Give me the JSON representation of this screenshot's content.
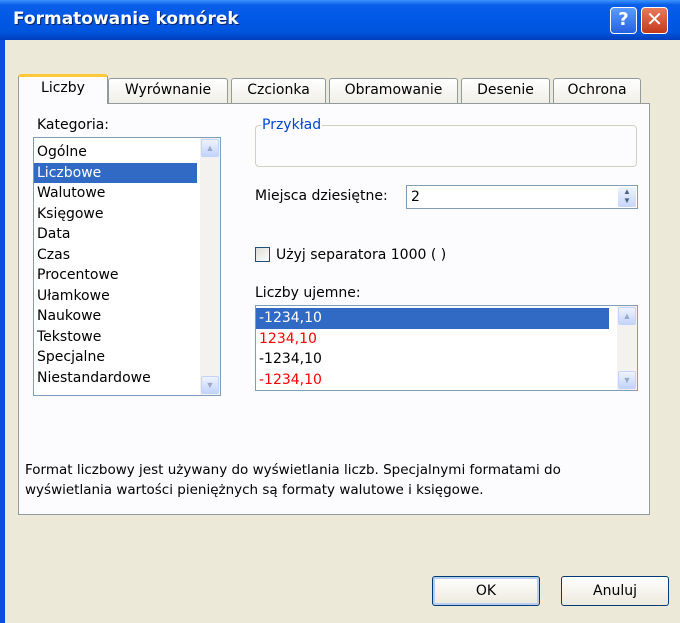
{
  "window": {
    "title": "Formatowanie komórek"
  },
  "tabs": [
    {
      "label": "Liczby"
    },
    {
      "label": "Wyrównanie"
    },
    {
      "label": "Czcionka"
    },
    {
      "label": "Obramowanie"
    },
    {
      "label": "Desenie"
    },
    {
      "label": "Ochrona"
    }
  ],
  "kategoria": {
    "label": "Kategoria:",
    "items": [
      "Ogólne",
      "Liczbowe",
      "Walutowe",
      "Księgowe",
      "Data",
      "Czas",
      "Procentowe",
      "Ułamkowe",
      "Naukowe",
      "Tekstowe",
      "Specjalne",
      "Niestandardowe"
    ],
    "selected": "Liczbowe"
  },
  "przyklad": {
    "label": "Przykład",
    "value": ""
  },
  "miejsca": {
    "label": "Miejsca dziesiętne:",
    "value": "2"
  },
  "separator": {
    "label": "Użyj separatora 1000 ( )",
    "checked": false
  },
  "ujemne": {
    "label": "Liczby ujemne:",
    "items": [
      {
        "text": "-1234,10",
        "color": "#000000"
      },
      {
        "text": "1234,10",
        "color": "#ff0000"
      },
      {
        "text": "-1234,10",
        "color": "#000000"
      },
      {
        "text": "-1234,10",
        "color": "#ff0000"
      }
    ],
    "selected_index": 0
  },
  "description": "Format liczbowy jest używany do wyświetlania liczb. Specjalnymi formatami do wyświetlania wartości pieniężnych są formaty walutowe i księgowe.",
  "buttons": {
    "ok": "OK",
    "cancel": "Anuluj"
  },
  "colors": {
    "title_bar": "#0055dd",
    "selection": "#316ac5",
    "dialog_bg": "#ece9d8",
    "negative_red": "#ff0000"
  }
}
